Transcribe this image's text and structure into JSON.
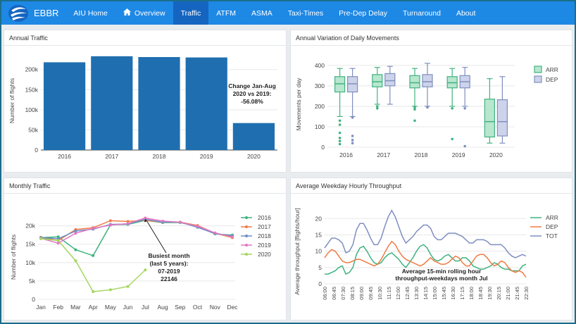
{
  "nav": {
    "brand": "EBBR",
    "items": [
      {
        "key": "aiu-home",
        "label": "AIU Home",
        "active": false
      },
      {
        "key": "overview",
        "label": "Overview",
        "active": false
      },
      {
        "key": "traffic",
        "label": "Traffic",
        "active": true
      },
      {
        "key": "atfm",
        "label": "ATFM",
        "active": false
      },
      {
        "key": "asma",
        "label": "ASMA",
        "active": false
      },
      {
        "key": "taxi-times",
        "label": "Taxi-Times",
        "active": false
      },
      {
        "key": "pre-dep-delay",
        "label": "Pre-Dep Delay",
        "active": false
      },
      {
        "key": "turnaround",
        "label": "Turnaround",
        "active": false
      },
      {
        "key": "about",
        "label": "About",
        "active": false
      }
    ]
  },
  "colors": {
    "nav": "#1e88e5",
    "active": "#1565c0",
    "bar": "#1f77b4",
    "arr": "#2ca02c",
    "dep": "#1f77b4"
  },
  "panels": {
    "annual": {
      "title": "Annual Traffic"
    },
    "variation": {
      "title": "Annual Variation of Daily Movements"
    },
    "monthly": {
      "title": "Monthly Traffic"
    },
    "hourly": {
      "title": "Average Weekday Hourly Throughput"
    }
  },
  "chart_data": [
    {
      "type": "bar",
      "id": "annual",
      "title": "Annual Traffic",
      "categories": [
        "2016",
        "2017",
        "2018",
        "2019",
        "2020"
      ],
      "values": [
        218000,
        233000,
        231000,
        230000,
        67000
      ],
      "ylabel": "Number of flights",
      "yticks": [
        0,
        50000,
        100000,
        150000,
        200000
      ],
      "ytick_labels": [
        "0",
        "50k",
        "100k",
        "150k",
        "200k"
      ],
      "ylim": [
        0,
        245000
      ],
      "color": "#1f6fb0",
      "annotation": [
        "Change Jan-Aug",
        "2020 vs 2019:",
        "-56.08%"
      ]
    },
    {
      "type": "box",
      "id": "variation",
      "title": "Annual Variation of Daily Movements",
      "categories": [
        "2016",
        "2017",
        "2018",
        "2019",
        "2020"
      ],
      "ylabel": "Movements per day",
      "ylim": [
        0,
        420
      ],
      "yticks": [
        0,
        100,
        200,
        300,
        400
      ],
      "series": [
        {
          "name": "ARR",
          "color": "#3fb37f",
          "fill": "#b8e6cf",
          "boxes": [
            {
              "min": 150,
              "q1": 270,
              "median": 310,
              "q3": 345,
              "max": 385,
              "outliers": [
                130,
                110,
                70,
                45,
                30,
                15
              ]
            },
            {
              "min": 210,
              "q1": 295,
              "median": 320,
              "q3": 355,
              "max": 390,
              "outliers": [
                200,
                190
              ]
            },
            {
              "min": 200,
              "q1": 290,
              "median": 315,
              "q3": 350,
              "max": 385,
              "outliers": [
                195,
                185,
                130
              ]
            },
            {
              "min": 200,
              "q1": 290,
              "median": 315,
              "q3": 345,
              "max": 385,
              "outliers": [
                190,
                40
              ]
            },
            {
              "min": 20,
              "q1": 50,
              "median": 125,
              "q3": 235,
              "max": 335,
              "outliers": []
            }
          ]
        },
        {
          "name": "DEP",
          "color": "#7f8fbf",
          "fill": "#cdd3ea",
          "boxes": [
            {
              "min": 150,
              "q1": 270,
              "median": 310,
              "q3": 345,
              "max": 385,
              "outliers": [
                145,
                55,
                35,
                20
              ]
            },
            {
              "min": 210,
              "q1": 300,
              "median": 325,
              "q3": 360,
              "max": 395,
              "outliers": []
            },
            {
              "min": 200,
              "q1": 295,
              "median": 320,
              "q3": 355,
              "max": 410,
              "outliers": [
                195
              ]
            },
            {
              "min": 200,
              "q1": 290,
              "median": 320,
              "q3": 350,
              "max": 390,
              "outliers": [
                190,
                5
              ]
            },
            {
              "min": 20,
              "q1": 55,
              "median": 125,
              "q3": 232,
              "max": 345,
              "outliers": []
            }
          ]
        }
      ]
    },
    {
      "type": "line",
      "id": "monthly",
      "title": "Monthly Traffic",
      "categories": [
        "Jan",
        "Feb",
        "Mar",
        "Apr",
        "May",
        "Jun",
        "Jul",
        "Aug",
        "Sep",
        "Oct",
        "Nov",
        "Dec"
      ],
      "ylabel": "Number of flights",
      "ylim": [
        0,
        23000
      ],
      "yticks": [
        0,
        5000,
        10000,
        15000,
        20000
      ],
      "ytick_labels": [
        "0",
        "5k",
        "10k",
        "15k",
        "20k"
      ],
      "series": [
        {
          "name": "2016",
          "color": "#3fb37f",
          "values": [
            16800,
            17000,
            13500,
            11900,
            20300,
            20400,
            21500,
            20900,
            20900,
            19900,
            17800,
            17500
          ]
        },
        {
          "name": "2017",
          "color": "#ef7b45",
          "values": [
            16900,
            16000,
            19000,
            19500,
            21400,
            21200,
            21500,
            21000,
            21000,
            20100,
            18000,
            16800
          ]
        },
        {
          "name": "2018",
          "color": "#6a8ec8",
          "values": [
            16800,
            16500,
            18600,
            19100,
            20400,
            20500,
            21800,
            21000,
            21000,
            19600,
            17900,
            17300
          ]
        },
        {
          "name": "2019",
          "color": "#e377c2",
          "values": [
            16600,
            15300,
            18000,
            19300,
            20200,
            20600,
            22146,
            21300,
            21000,
            19900,
            18100,
            17000
          ]
        },
        {
          "name": "2020",
          "color": "#a4d65e",
          "values": [
            16500,
            16000,
            10500,
            2100,
            2600,
            3500,
            8000
          ]
        }
      ],
      "annotation": [
        "Busiest month",
        "(last 5 years):",
        "07-2019",
        "22146"
      ]
    },
    {
      "type": "line",
      "id": "hourly",
      "title": "Average Weekday Hourly Throughput",
      "ylabel": "Average throughput [flights/hour]",
      "ylim": [
        0,
        22
      ],
      "yticks": [
        0,
        5,
        10,
        15,
        20
      ],
      "x_labels": [
        "06:00",
        "06:45",
        "07:30",
        "08:15",
        "09:00",
        "09:45",
        "10:30",
        "11:15",
        "12:00",
        "12:45",
        "13:30",
        "14:15",
        "15:00",
        "15:45",
        "16:30",
        "17:15",
        "18:00",
        "18:45",
        "19:30",
        "20:15",
        "21:00",
        "21:45",
        "22:30"
      ],
      "series": [
        {
          "name": "ARR",
          "color": "#3fb37f",
          "values": [
            3,
            3,
            3.5,
            4,
            5,
            5.5,
            3,
            3.5,
            5,
            9,
            11,
            11.5,
            10,
            8,
            6.5,
            6,
            6.5,
            8,
            9,
            9.5,
            8.5,
            7.5,
            6,
            5,
            6.5,
            8,
            10,
            11.5,
            12,
            11,
            9,
            7.5,
            7,
            7.5,
            8.5,
            9,
            8,
            7,
            7,
            8,
            8,
            7,
            5.5,
            5,
            4.5,
            4.5,
            5,
            5.5,
            6.5,
            6,
            5,
            4.5,
            4.5,
            4,
            4,
            4,
            5.5,
            6
          ]
        },
        {
          "name": "DEP",
          "color": "#ef7b45",
          "values": [
            8,
            9.5,
            10.5,
            10,
            8.5,
            7,
            6.5,
            6.5,
            7,
            7.5,
            7.5,
            7,
            6.5,
            6,
            5.5,
            6,
            7.5,
            9.5,
            11.5,
            13,
            12,
            10,
            8.5,
            7.5,
            7,
            6.5,
            6,
            5.5,
            6,
            7,
            8,
            7,
            6.5,
            6,
            6,
            6.5,
            7.5,
            8.5,
            8,
            6.5,
            5.5,
            5.5,
            7,
            8.5,
            9,
            9,
            8,
            6.5,
            5.5,
            6,
            7,
            6.5,
            5,
            4,
            3.5,
            4,
            3.5,
            2
          ]
        },
        {
          "name": "TOT",
          "color": "#7f8fbf",
          "values": [
            11,
            12.5,
            14,
            14,
            13.5,
            12.5,
            9.5,
            10,
            12,
            16.5,
            18.5,
            18.5,
            16.5,
            14,
            12,
            12,
            14,
            17.5,
            20.5,
            22.5,
            20.5,
            17.5,
            14.5,
            12.5,
            13.5,
            14.5,
            16,
            17,
            18,
            18,
            17,
            14.5,
            13.5,
            13.5,
            14.5,
            15.5,
            15.5,
            15.5,
            15,
            14.5,
            13.5,
            12.5,
            12.5,
            13.5,
            13.5,
            13.5,
            13,
            12,
            12,
            12,
            12,
            11,
            9.5,
            8.5,
            8,
            8.5,
            9,
            8.5
          ]
        }
      ],
      "annotation": [
        "Average 15-min rolling hour",
        "throughput-weekdays month Jul"
      ]
    }
  ]
}
